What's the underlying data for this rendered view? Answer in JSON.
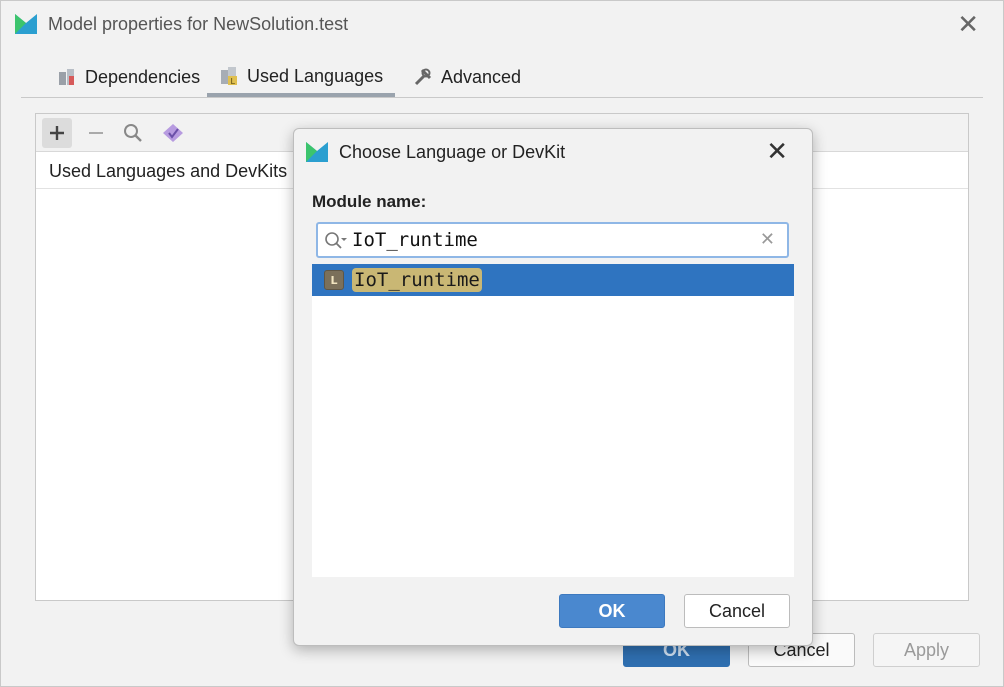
{
  "window": {
    "title": "Model properties for NewSolution.test",
    "close_icon": "close-icon"
  },
  "tabs": [
    {
      "label": "Dependencies",
      "icon": "dependencies-icon"
    },
    {
      "label": "Used Languages",
      "icon": "used-languages-icon",
      "active": true
    },
    {
      "label": "Advanced",
      "icon": "tools-icon"
    }
  ],
  "toolbar": {
    "add": "add-icon",
    "remove": "remove-icon",
    "search": "search-icon",
    "devkit": "devkit-icon"
  },
  "panel": {
    "header": "Used Languages and DevKits"
  },
  "footer": {
    "ok": "OK",
    "cancel": "Cancel",
    "apply": "Apply"
  },
  "dialog": {
    "title": "Choose Language or DevKit",
    "label": "Module name:",
    "search_value": "IoT_runtime",
    "results": [
      {
        "name": "IoT_runtime",
        "badge": "L",
        "selected": true
      }
    ],
    "ok": "OK",
    "cancel": "Cancel"
  },
  "colors": {
    "accent": "#2f74c0",
    "primary_button": "#4a88cf",
    "match_highlight": "#c9b774"
  }
}
